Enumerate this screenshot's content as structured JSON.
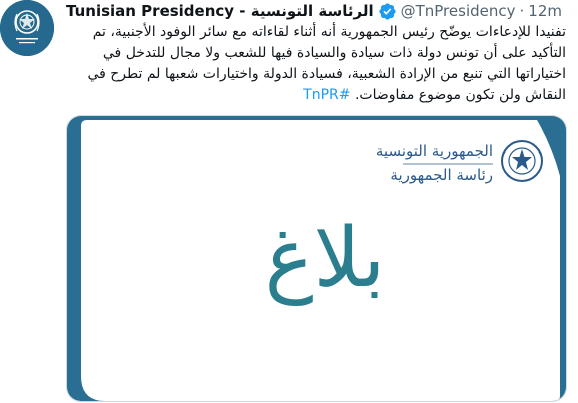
{
  "tweet": {
    "display_name": "Tunisian Presidency - الرئاسة التونسية",
    "handle": "@TnPresidency",
    "separator": "·",
    "time": "12m",
    "text": "تفنيدا للإدعاءات يوضّح رئيس الجمهورية أنه أثناء لقاءاته مع سائر الوفود الأجنبية، تم التأكيد على أن تونس دولة ذات سيادة والسيادة فيها للشعب ولا مجال للتدخل في اختياراتها التي تنبع من الإرادة الشعبية، فسيادة الدولة واختيارات شعبها لم تطرح في النقاش ولن تكون موضوع مفاوضات.",
    "hashtag": "#TnPR"
  },
  "media": {
    "big_word": "بلاغ",
    "logo_line1": "الجمهورية التونسية",
    "logo_line2": "رئاسة الجمهورية"
  },
  "colors": {
    "avatar_bg": "#256a8e",
    "brand_blue": "#1d9bf0",
    "card_teal": "#2a6f93",
    "word_teal": "#2b7e8e"
  },
  "icons": {
    "verified": "verified-badge-icon",
    "avatar": "presidential-seal-icon",
    "card_emblem": "presidential-emblem-icon"
  }
}
